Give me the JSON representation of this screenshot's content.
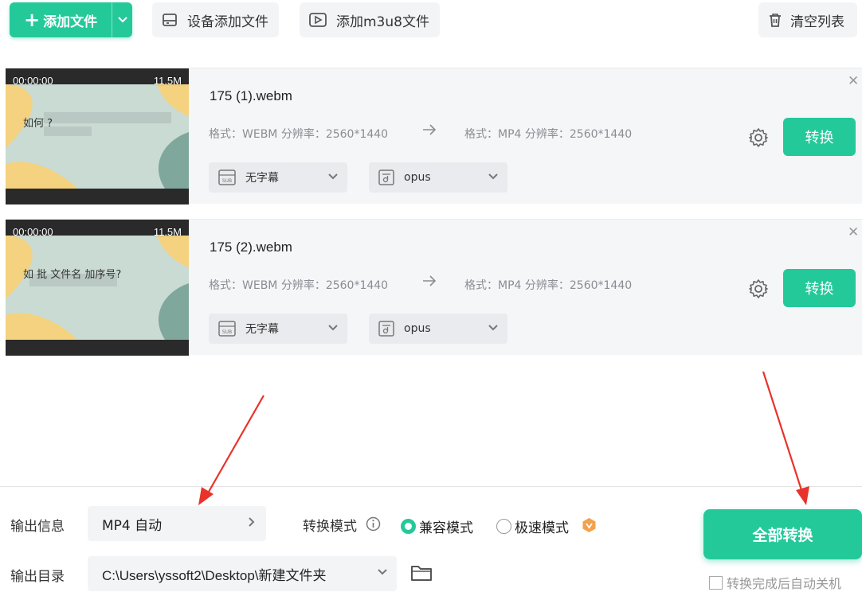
{
  "toolbar": {
    "add_file_label": "添加文件",
    "device_add_label": "设备添加文件",
    "add_m3u8_label": "添加m3u8文件",
    "clear_list_label": "清空列表"
  },
  "files": [
    {
      "time": "00:00:00",
      "size": "11.5M",
      "caption": "如何                 ?",
      "name": "175 (1).webm",
      "src_meta": "格式：WEBM  分辨率：2560*1440",
      "dst_meta": "格式：MP4   分辨率：2560*1440",
      "subtitle_select": "无字幕",
      "audio_select": "opus",
      "convert_label": "转换"
    },
    {
      "time": "00:00:00",
      "size": "11.5M",
      "caption": "如   批    文件名     加序号?",
      "name": "175 (2).webm",
      "src_meta": "格式：WEBM  分辨率：2560*1440",
      "dst_meta": "格式：MP4   分辨率：2560*1440",
      "subtitle_select": "无字幕",
      "audio_select": "opus",
      "convert_label": "转换"
    }
  ],
  "bottom": {
    "output_info_label": "输出信息",
    "output_info_value": "MP4 自动",
    "convert_mode_label": "转换模式",
    "mode_compat": "兼容模式",
    "mode_fast": "极速模式",
    "output_dir_label": "输出目录",
    "output_dir_value": "C:\\Users\\yssoft2\\Desktop\\新建文件夹",
    "convert_all_label": "全部转换",
    "auto_shutdown_label": "转换完成后自动关机"
  },
  "colors": {
    "accent": "#24c99a",
    "annotation_arrow": "#e8332b"
  }
}
